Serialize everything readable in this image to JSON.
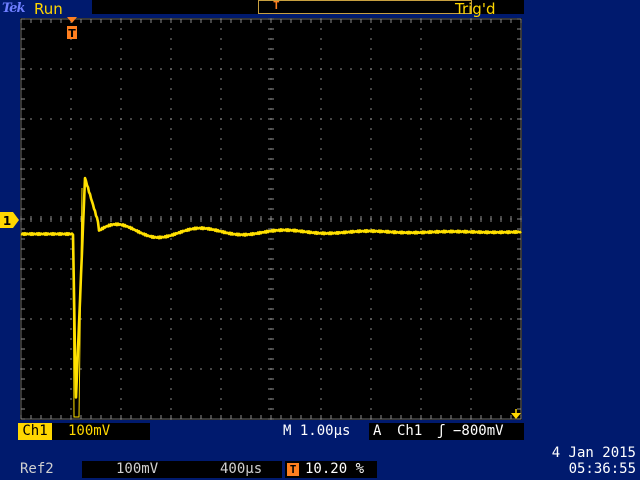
{
  "header": {
    "logo": "Tek",
    "acquisition_state": "Run",
    "trigger_state": "Trig'd",
    "record_trigger_mark": "T"
  },
  "channel1": {
    "label": "Ch1",
    "marker": "1",
    "scale": "100mV",
    "color": "#ffd700"
  },
  "timebase": {
    "label": "M 1.00µs"
  },
  "trigger": {
    "mode": "A",
    "source": "Ch1",
    "slope_symbol": "ʃ",
    "level": "−800mV",
    "position_icon": "T",
    "position_value": "10.20 %",
    "position_color": "#ff7f1f"
  },
  "ref2": {
    "label": "Ref2",
    "scale": "100mV",
    "timebase": "400µs"
  },
  "clock": {
    "date": "4 Jan  2015",
    "time": "05:36:55"
  },
  "waveform": {
    "description_units": "divisions",
    "baseline_div": 0.1,
    "grid_divisions": {
      "x": 10,
      "y": 8
    },
    "colors": {
      "trace": "#ffe000",
      "grid": "#8a8a8a",
      "screen": "#000000",
      "frame": "#001a6e"
    }
  }
}
